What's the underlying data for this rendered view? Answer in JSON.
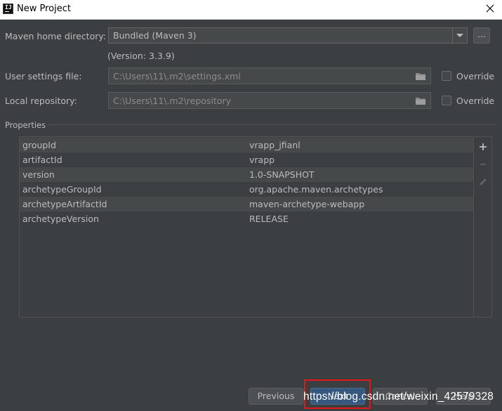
{
  "window": {
    "title": "New Project",
    "app_icon_text": "IJ",
    "close_icon": "close-icon"
  },
  "maven": {
    "home_label": "Maven home directory:",
    "home_value": "Bundled (Maven 3)",
    "browse_label": "...",
    "version_text": "(Version: 3.3.9)",
    "settings_label": "User settings file:",
    "settings_value": "C:\\Users\\11\\.m2\\settings.xml",
    "repo_label": "Local repository:",
    "repo_value": "C:\\Users\\11\\.m2\\repository",
    "override_label": "Override"
  },
  "properties": {
    "section_title": "Properties",
    "rows": [
      {
        "key": "groupId",
        "value": "vrapp_jfianl"
      },
      {
        "key": "artifactId",
        "value": "vrapp"
      },
      {
        "key": "version",
        "value": "1.0-SNAPSHOT"
      },
      {
        "key": "archetypeGroupId",
        "value": "org.apache.maven.archetypes"
      },
      {
        "key": "archetypeArtifactId",
        "value": "maven-archetype-webapp"
      },
      {
        "key": "archetypeVersion",
        "value": "RELEASE"
      }
    ],
    "tools": [
      "add-icon",
      "remove-icon",
      "edit-icon"
    ]
  },
  "footer": {
    "previous_label": "Previous",
    "next_label": "Next",
    "cancel_label": "Cancel",
    "help_label": "Help",
    "watermark": "https://blog.csdn.net/weixin_42579328"
  },
  "colors": {
    "background": "#3c3f41",
    "field": "#45494a",
    "primary_button": "#365880",
    "highlight": "#e8141b"
  }
}
